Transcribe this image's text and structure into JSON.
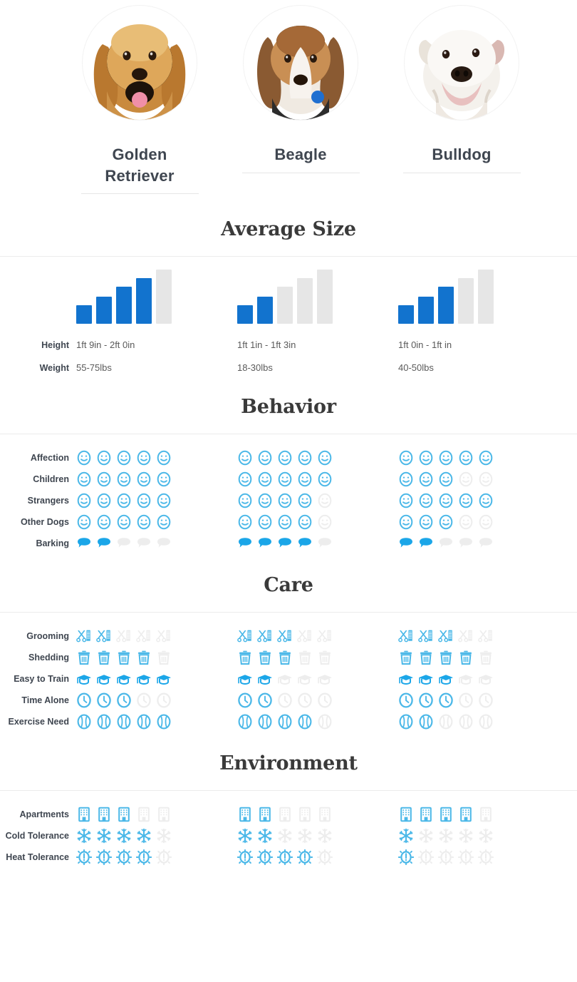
{
  "colors": {
    "bar_active": "#1273ce",
    "bar_inactive": "#e6e6e6",
    "icon_active": "#4bb8e8",
    "icon_active_solid": "#1ba6e8",
    "icon_inactive": "#ededed",
    "heading": "#3a3a3a",
    "label": "#3f4650"
  },
  "breeds": [
    {
      "name": "Golden Retriever",
      "image": "golden-retriever-photo"
    },
    {
      "name": "Beagle",
      "image": "beagle-photo"
    },
    {
      "name": "Bulldog",
      "image": "bulldog-photo"
    }
  ],
  "sections": [
    {
      "id": "average-size",
      "title": "Average Size",
      "type": "size",
      "bars_total": 5,
      "bar_values": [
        4,
        2,
        3
      ],
      "text_rows": [
        {
          "label": "Height",
          "values": [
            "1ft 9in - 2ft 0in",
            "1ft 1in - 1ft 3in",
            "1ft 0in - 1ft in"
          ]
        },
        {
          "label": "Weight",
          "values": [
            "55-75lbs",
            "18-30lbs",
            "40-50lbs"
          ]
        }
      ]
    },
    {
      "id": "behavior",
      "title": "Behavior",
      "type": "rating",
      "max": 5,
      "rows": [
        {
          "label": "Affection",
          "icon": "smiley-icon",
          "values": [
            5,
            5,
            5
          ]
        },
        {
          "label": "Children",
          "icon": "smiley-icon",
          "values": [
            5,
            5,
            3
          ]
        },
        {
          "label": "Strangers",
          "icon": "smiley-icon",
          "values": [
            5,
            4,
            5
          ]
        },
        {
          "label": "Other Dogs",
          "icon": "smiley-icon",
          "values": [
            5,
            4,
            3
          ]
        },
        {
          "label": "Barking",
          "icon": "speech-bubble-icon",
          "values": [
            2,
            4,
            2
          ]
        }
      ]
    },
    {
      "id": "care",
      "title": "Care",
      "type": "rating",
      "max": 5,
      "rows": [
        {
          "label": "Grooming",
          "icon": "scissors-comb-icon",
          "values": [
            2,
            3,
            3
          ]
        },
        {
          "label": "Shedding",
          "icon": "trash-can-icon",
          "values": [
            4,
            3,
            4
          ]
        },
        {
          "label": "Easy to Train",
          "icon": "graduation-cap-icon",
          "values": [
            5,
            2,
            3
          ]
        },
        {
          "label": "Time Alone",
          "icon": "clock-icon",
          "values": [
            3,
            2,
            3
          ]
        },
        {
          "label": "Exercise Need",
          "icon": "baseball-icon",
          "values": [
            5,
            4,
            2
          ]
        }
      ]
    },
    {
      "id": "environment",
      "title": "Environment",
      "type": "rating",
      "max": 5,
      "rows": [
        {
          "label": "Apartments",
          "icon": "building-icon",
          "values": [
            3,
            2,
            4
          ]
        },
        {
          "label": "Cold Tolerance",
          "icon": "snowflake-icon",
          "values": [
            4,
            2,
            1
          ]
        },
        {
          "label": "Heat Tolerance",
          "icon": "sun-icon",
          "values": [
            4,
            4,
            1
          ]
        }
      ]
    }
  ]
}
